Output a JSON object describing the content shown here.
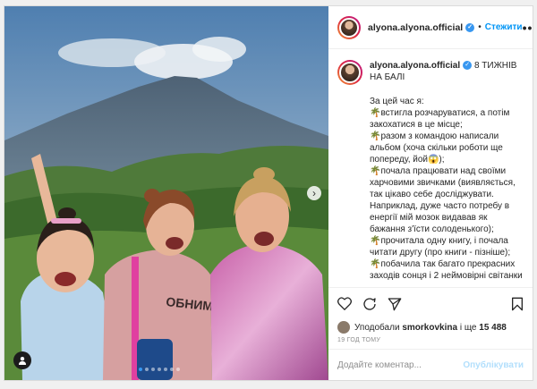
{
  "header": {
    "username": "alyona.alyona.official",
    "separator": "•",
    "follow_label": "Стежити",
    "more_label": "•••"
  },
  "media": {
    "shirt_text": "ОБНИМУ",
    "next_label": "›",
    "slide_dots": 7,
    "active_dot": 0
  },
  "caption": {
    "username": "alyona.alyona.official",
    "headline": "8 ТИЖНІВ НА БАЛІ",
    "lines": [
      "За цей час я:",
      "🌴встигла розчаруватися, а потім закохатися в це місце;",
      "🌴разом з командою написали альбом (хоча скільки роботи ще попереду, йой😱);",
      "🌴почала працювати над своїми харчовими звичками (виявляється, так цікаво себе досліджувати. Наприклад, дуже часто потребу в енергії мій мозок видавав як бажання з'їсти солоденького);",
      "🌴прочитала одну книгу, і почала читати другу (про книги - пізніше);",
      "🌴побачила так багато прекрасних заходів сонця і 2 неймовірні світанки"
    ]
  },
  "likes": {
    "prefix": "Уподобали",
    "user": "smorkovkina",
    "middle": "і ще",
    "count": "15 488"
  },
  "timestamp": "19 ГОД ТОМУ",
  "comment": {
    "placeholder": "Додайте коментар...",
    "publish_label": "Опублікувати"
  },
  "colors": {
    "accent": "#0095f6",
    "verified": "#3897f0"
  }
}
